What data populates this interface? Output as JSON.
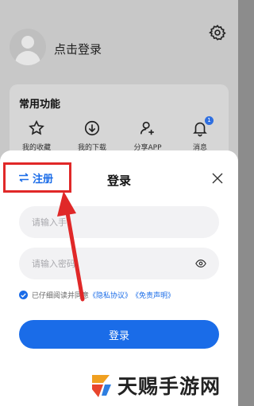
{
  "profile": {
    "login_link": "点击登录"
  },
  "functions": {
    "title": "常用功能",
    "items": [
      {
        "label": "我的收藏",
        "icon": "star-icon"
      },
      {
        "label": "我的下载",
        "icon": "download-icon"
      },
      {
        "label": "分享APP",
        "icon": "share-user-icon"
      },
      {
        "label": "消息",
        "icon": "bell-icon",
        "badge": "1"
      }
    ]
  },
  "sheet": {
    "register_label": "注册",
    "title": "登录",
    "phone_placeholder": "请输入手",
    "password_placeholder": "请输入密码",
    "agreement": {
      "prefix": "已仔细阅读并同意",
      "privacy": "《隐私协议》",
      "disclaimer": "《免责声明》"
    },
    "submit_label": "登录"
  },
  "watermark": {
    "text": "天赐手游网"
  },
  "colors": {
    "accent": "#1a6ce8",
    "highlight": "#e02828"
  }
}
